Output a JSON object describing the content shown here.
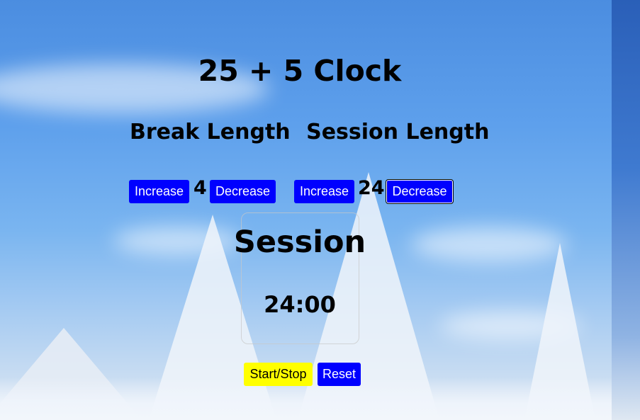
{
  "app": {
    "title": "25 + 5 Clock"
  },
  "break": {
    "label": "Break Length",
    "increase_label": "Increase",
    "value": "4",
    "decrease_label": "Decrease"
  },
  "session": {
    "label": "Session Length",
    "increase_label": "Increase",
    "value": "24",
    "decrease_label": "Decrease"
  },
  "timer": {
    "label": "Session",
    "time_left": "24:00"
  },
  "controls": {
    "start_stop_label": "Start/Stop",
    "reset_label": "Reset"
  },
  "colors": {
    "button_blue": "#0000ff",
    "start_yellow": "#ffff00"
  }
}
